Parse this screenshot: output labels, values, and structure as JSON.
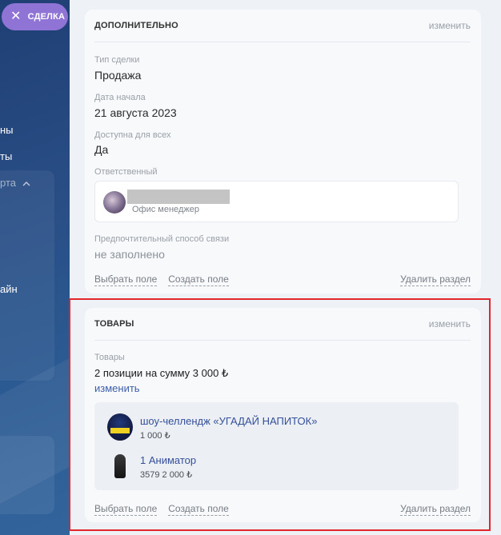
{
  "sidebar": {
    "deal_button_label": "СДЕЛКА",
    "fragments": [
      "ны",
      "ты",
      "рта",
      "айн"
    ]
  },
  "extra_section": {
    "title": "ДОПОЛНИТЕЛЬНО",
    "edit_label": "изменить",
    "fields": [
      {
        "label": "Тип сделки",
        "value": "Продажа"
      },
      {
        "label": "Дата начала",
        "value": "21 августа 2023"
      },
      {
        "label": "Доступна для всех",
        "value": "Да"
      },
      {
        "label": "Ответственный",
        "value": ""
      },
      {
        "label": "Предпочтительный способ связи",
        "value": "не заполнено"
      }
    ],
    "responsible": {
      "name": "",
      "role": "Офис менеджер"
    },
    "footer": {
      "choose_field": "Выбрать поле",
      "create_field": "Создать поле",
      "delete_section": "Удалить раздел"
    }
  },
  "goods_section": {
    "title": "ТОВАРЫ",
    "edit_label": "изменить",
    "field_label": "Товары",
    "summary": "2 позиции на сумму 3 000 ₺",
    "change_link": "изменить",
    "products": [
      {
        "title": "шоу-челлендж «УГАДАЙ НАПИТОК»",
        "meta": "1 000 ₺"
      },
      {
        "title": "1 Аниматор",
        "meta": "3579   2 000 ₺"
      }
    ],
    "footer": {
      "choose_field": "Выбрать поле",
      "create_field": "Создать поле",
      "delete_section": "Удалить раздел"
    }
  },
  "colors": {
    "sidebar": "#2a5088",
    "deal_button": "#8f74d6",
    "link": "#3c5fa8",
    "highlight_border": "#e0262b"
  }
}
